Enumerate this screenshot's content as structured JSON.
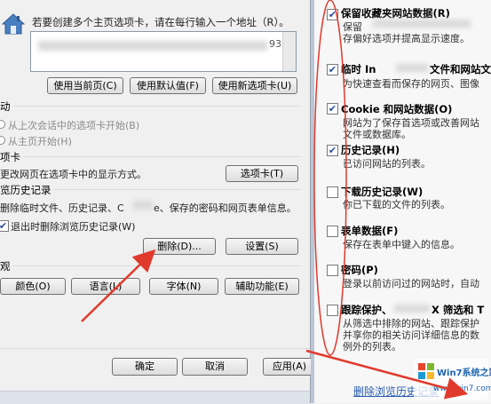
{
  "left": {
    "homepage_desc": "若要创建多个主页选项卡，请在每行输入一个地址（R）。",
    "homepage_url_end": "93",
    "btn_use_current": "使用当前页(C)",
    "btn_use_default": "使用默认值(F)",
    "btn_use_new_tab": "使用新选项卡(U)",
    "startup_heading": "动",
    "radio_last_session": "从上次会话中的选项卡开始(B)",
    "radio_home": "从主页开始(H)",
    "tabs_heading": "项卡",
    "tabs_desc": "更改网页在选项卡中的显示方式。",
    "btn_tabs": "选项卡(T)",
    "history_heading": "览历史记录",
    "history_desc_1": "删除临时文件、历史记录、C",
    "history_desc_2": "e、保存的密码和网页表单信息。",
    "check_delete_on_exit": "退出时删除浏览历史记录(W)",
    "btn_delete": "删除(D)...",
    "btn_settings": "设置(S)",
    "appearance_heading": "观",
    "btn_colors": "颜色(O)",
    "btn_languages": "语言(L)",
    "btn_fonts": "字体(N)",
    "btn_accessibility": "辅助功能(E)",
    "btn_ok": "确定",
    "btn_cancel": "取消",
    "btn_apply": "应用(A)"
  },
  "right": {
    "items": [
      {
        "title": "保留收藏夹网站数据(R)",
        "desc": [
          "保留",
          "存偏好选项并提高显示速度。"
        ],
        "checked": true
      },
      {
        "title": "临时 In",
        "title_tail": "文件和网站文",
        "desc": [
          "为快速查看而保存的网页、图像"
        ],
        "checked": true
      },
      {
        "title": "Cookie 和网站数据(O)",
        "desc": [
          "网站为了保存首选项或改善网站",
          "文件或数据库。"
        ],
        "checked": true
      },
      {
        "title": "历史记录(H)",
        "desc": [
          "已访问网站的列表。"
        ],
        "checked": true
      },
      {
        "title": "下载历史记录(W)",
        "desc": [
          "你已下载的文件的列表。"
        ],
        "checked": false
      },
      {
        "title": "表单数据(F)",
        "desc": [
          "保存在表单中键入的信息。"
        ],
        "checked": false
      },
      {
        "title": "密码(P)",
        "desc": [
          "登录以前访问过的网站时，自动"
        ],
        "checked": false
      },
      {
        "title": "跟踪保护、",
        "title_tail": "X 筛选和 T",
        "desc": [
          "从筛选中排除的网站、跟踪保护",
          "并享你的相关访问详细信息的数",
          "例外的列表。"
        ],
        "checked": false
      }
    ],
    "bottom_link": "删除浏览历史记录",
    "watermark_brand": "Win7系统之家",
    "watermark_url": "www.win7.com"
  },
  "colors": {
    "annotation_red": "#e03a2c",
    "check_blue": "#2b4d9b"
  }
}
